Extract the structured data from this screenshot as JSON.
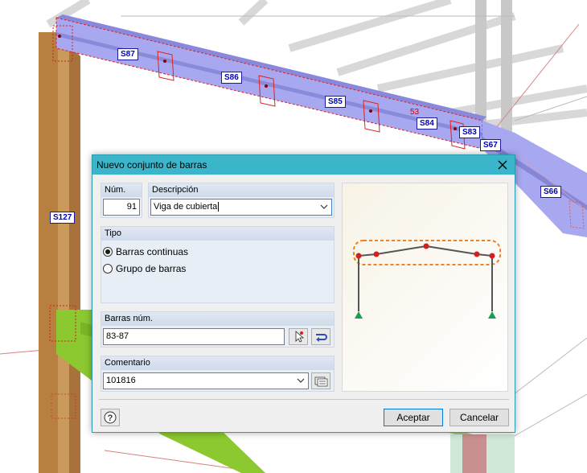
{
  "model_labels": {
    "s87": "S87",
    "s86": "S86",
    "s85": "S85",
    "s84": "S84",
    "s83": "S83",
    "s67": "S67",
    "s66": "S66",
    "s127": "S127",
    "node53": "53"
  },
  "dialog": {
    "title": "Nuevo conjunto de barras",
    "num_label": "Núm.",
    "num_value": "91",
    "desc_label": "Descripción",
    "desc_value": "Viga de cubierta",
    "tipo_label": "Tipo",
    "tipo_options": [
      "Barras continuas",
      "Grupo de barras"
    ],
    "tipo_selected": "Barras continuas",
    "barras_label": "Barras núm.",
    "barras_value": "83-87",
    "comentario_label": "Comentario",
    "comentario_value": "101816",
    "accept_label": "Aceptar",
    "cancel_label": "Cancelar"
  },
  "colors": {
    "title_bar": "#3bb5c9",
    "beam_selected": "#9a9ae8",
    "selection_red": "#e02020",
    "column": "#c08a48",
    "green_beam": "#80c020",
    "accept_border": "#0078d7"
  },
  "icons": [
    "close-icon",
    "dropdown-arrow-icon",
    "pick-cursor-icon",
    "select-members-icon",
    "library-icon",
    "help-icon",
    "support-icon"
  ]
}
